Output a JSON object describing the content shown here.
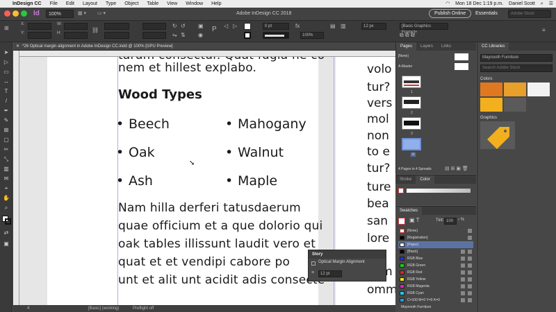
{
  "menubar": {
    "items": [
      "InDesign CC",
      "File",
      "Edit",
      "Layout",
      "Type",
      "Object",
      "Table",
      "View",
      "Window",
      "Help"
    ],
    "clock": "Mon 18 Dec  1:19 p.m.",
    "user": "Daniel Scott"
  },
  "appbar": {
    "zoom": "100%",
    "title": "Adobe InDesign CC 2018",
    "publish": "Publish Online",
    "workspace": "Essentials",
    "search_placeholder": "Adobe Stock"
  },
  "control": {
    "stroke_weight": "0 pt",
    "percent1": "100%",
    "percent2": "100%",
    "pt_value": "0 pt",
    "size": "12 px",
    "frame_style": "[Basic Graphics Frame]+"
  },
  "document": {
    "tab": "*26 Optical margin alignment in Adobe InDesign CC.indd @ 100% [GPU Preview]",
    "top_line1": "tarum consectur. Quat fugia ne co",
    "top_line2": "nem et hillest explabo.",
    "heading": "Wood Types",
    "bullets_left": [
      "Beech",
      "Oak",
      "Ash"
    ],
    "bullets_right": [
      "Mahogany",
      "Walnut",
      "Maple"
    ],
    "bullet_char": "•",
    "body_lines": [
      "Nam hilla derferi tatusdaerum",
      "quae officium et a que dolorio qui",
      "oak tables illissunt laudit vero et",
      "quat et et vendipi cabore po",
      "unt et alit unt acidit adis consecte"
    ],
    "right_column": [
      "volo",
      "tur?",
      "vers",
      "mol",
      "non",
      "to e",
      "tur?",
      "ture",
      "bea",
      "san",
      "lore",
      "cum",
      "omm"
    ]
  },
  "story_panel": {
    "title": "Story",
    "option": "Optical Margin Alignment",
    "size": "12 pt"
  },
  "status": {
    "page": "4",
    "style": "[Basic] (working)",
    "preflight": "Preflight off"
  },
  "pages_panel": {
    "tabs": [
      "Pages",
      "Layers",
      "Links"
    ],
    "none": "[None]",
    "master": "A-Master",
    "page_numbers": [
      "1",
      "2",
      "3",
      "4"
    ],
    "summary": "4 Pages in 4 Spreads"
  },
  "color_panel": {
    "tabs": [
      "Stroke",
      "Color"
    ]
  },
  "swatches_panel": {
    "title": "Swatches",
    "tint_label": "Tint:",
    "tint": "100",
    "swatches": [
      {
        "name": "[None]",
        "color": "#ffffff"
      },
      {
        "name": "[Registration]",
        "color": "#000000"
      },
      {
        "name": "[Paper]",
        "color": "#ffffff"
      },
      {
        "name": "[Black]",
        "color": "#000000"
      },
      {
        "name": "RGB Blue",
        "color": "#1a2cf2"
      },
      {
        "name": "RGB Green",
        "color": "#1ec81e"
      },
      {
        "name": "RGB Red",
        "color": "#e52020"
      },
      {
        "name": "RGB Yellow",
        "color": "#f0e020"
      },
      {
        "name": "RGB Magenta",
        "color": "#e020c8"
      },
      {
        "name": "RGB Cyan",
        "color": "#20c8e6"
      },
      {
        "name": "C=100 M=0 Y=0 K=0",
        "color": "#1aa0e0"
      }
    ],
    "group": "Maynooth Furniture"
  },
  "cc_libraries": {
    "title": "CC Libraries",
    "library": "Maynooth Furniture",
    "search_placeholder": "Search Adobe Stock",
    "colors_label": "Colors",
    "graphics_label": "Graphics",
    "color_swatches": [
      "#e07820",
      "#e8a02a",
      "#f2f2f2",
      "#f2b01e",
      "#5a5a5a"
    ]
  }
}
